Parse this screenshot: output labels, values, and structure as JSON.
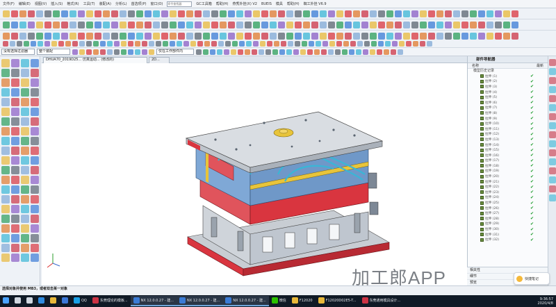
{
  "menubar": {
    "items": [
      "文件(F)",
      "编辑(E)",
      "视图(V)",
      "插入(S)",
      "格式(R)",
      "工具(T)",
      "装配(A)",
      "分析(L)",
      "首选项(P)",
      "窗口(O)",
      "GC工具箱",
      "帮助(H)",
      "燕秀外挂(X) V2",
      "BUEIS",
      "模具",
      "帮助(H)",
      "蜘工外挂 V6.9"
    ],
    "search_placeholder": "命令查找器"
  },
  "filterbar": {
    "selection_filter": "没有选择过滤器",
    "scope": "整个装配",
    "option": "仅在工作部件内"
  },
  "tabs": [
    {
      "label": "DHUA70_2019D25...  仿真运动...  (修改的)",
      "active": true
    },
    {
      "label": "2D...",
      "active": false
    }
  ],
  "navigator": {
    "title": "部件导航器",
    "col_name": "名称",
    "col_latest": "最新",
    "root": "模型历史记录",
    "items": [
      "拉伸 (1)",
      "拉伸 (2)",
      "拉伸 (3)",
      "拉伸 (4)",
      "拉伸 (5)",
      "拉伸 (6)",
      "拉伸 (7)",
      "拉伸 (8)",
      "拉伸 (9)",
      "拉伸 (10)",
      "拉伸 (11)",
      "拉伸 (12)",
      "拉伸 (13)",
      "拉伸 (14)",
      "拉伸 (15)",
      "拉伸 (16)",
      "拉伸 (17)",
      "拉伸 (18)",
      "拉伸 (19)",
      "拉伸 (20)",
      "拉伸 (21)",
      "拉伸 (22)",
      "拉伸 (23)",
      "拉伸 (24)",
      "拉伸 (25)",
      "拉伸 (26)",
      "拉伸 (27)",
      "拉伸 (28)",
      "拉伸 (29)",
      "拉伸 (30)",
      "拉伸 (31)",
      "拉伸 (32)"
    ],
    "bottom_panels": [
      "相关性",
      "细节",
      "预览"
    ]
  },
  "statusbar": {
    "line1": "选择对象并使用 MB3，或者双击某一对象",
    "line2": ""
  },
  "taskbar": {
    "items": [
      {
        "label": "",
        "icon": "windows-start",
        "color": "#4aa3ff"
      },
      {
        "label": "",
        "icon": "search-icon",
        "color": "#cfd6df"
      },
      {
        "label": "",
        "icon": "task-view-icon",
        "color": "#cfd6df"
      },
      {
        "label": "",
        "icon": "edge-icon",
        "color": "#2e8be0"
      },
      {
        "label": "",
        "icon": "folder-icon",
        "color": "#e8b83a"
      },
      {
        "label": "",
        "icon": "store-icon",
        "color": "#3b78d8"
      },
      {
        "label": "QQ",
        "icon": "qq-icon",
        "color": "#1aa0e6"
      },
      {
        "label": "东莞理论的模板...",
        "icon": "app-icon",
        "color": "#cc3344"
      },
      {
        "label": "NX 12.0.0.27 - 建...",
        "icon": "nx-icon",
        "color": "#3a7bd5"
      },
      {
        "label": "NX 12.0.0.27 - 建...",
        "icon": "nx-icon",
        "color": "#3a7bd5"
      },
      {
        "label": "NX 12.0.0.27 - 建...",
        "icon": "nx-icon",
        "color": "#3a7bd5"
      },
      {
        "label": "微信",
        "icon": "wechat-icon",
        "color": "#2dc100"
      },
      {
        "label": "F12020",
        "icon": "folder-icon",
        "color": "#e8b83a"
      },
      {
        "label": "F12020D02E5-T...",
        "icon": "folder-icon",
        "color": "#e8b83a"
      },
      {
        "label": "东莞通用模具设计...",
        "icon": "app-icon",
        "color": "#cc3344"
      }
    ],
    "time": "9:36:57",
    "date": "2020/4/8"
  },
  "watermark": "加工郎APP",
  "notes_badge": "快捷笔记",
  "colors": {
    "plate_top": "#d9dde2",
    "plate_red": "#d9353f",
    "mold_blue": "#7fa8d6",
    "pipe_cyan": "#39b6d6",
    "yellow": "#e8c43a",
    "accent": "#1a9a2a"
  }
}
